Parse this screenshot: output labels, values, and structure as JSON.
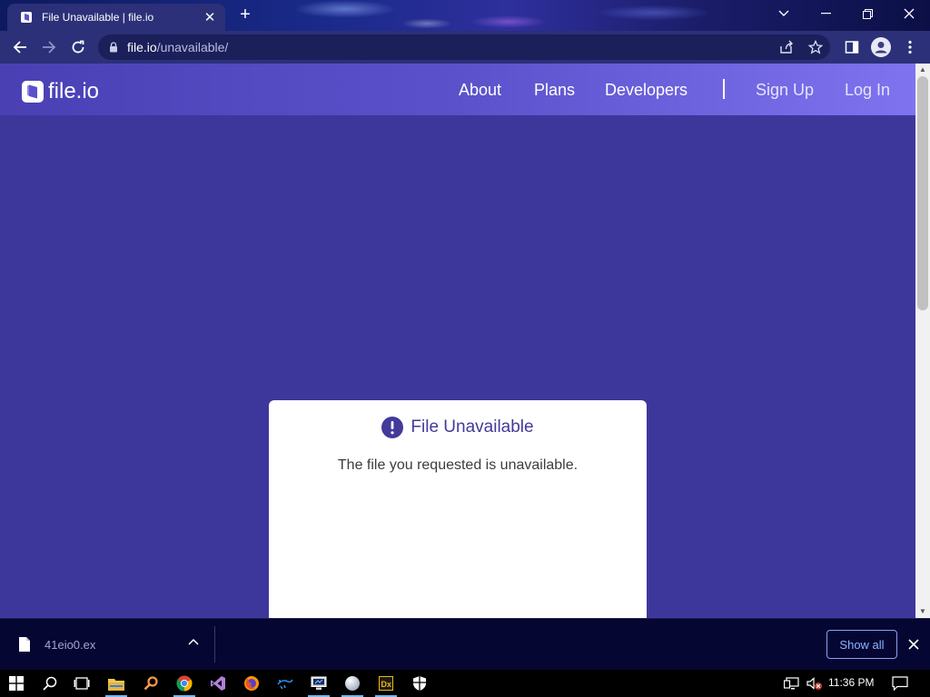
{
  "browser": {
    "tab": {
      "title": "File Unavailable | file.io"
    },
    "address": {
      "host": "file.io",
      "path": "/unavailable/"
    }
  },
  "site": {
    "logo_text": "file.io",
    "nav": {
      "about": "About",
      "plans": "Plans",
      "developers": "Developers",
      "sign_up": "Sign Up",
      "log_in": "Log In"
    },
    "card": {
      "title": "File Unavailable",
      "message": "The file you requested is unavailable."
    },
    "colors": {
      "page_bg": "#3e379b",
      "accent": "#433a9a",
      "header_end": "#7f73ef"
    }
  },
  "download_bar": {
    "file_name": "41eio0.ex",
    "show_all": "Show all"
  },
  "taskbar": {
    "clock": "11:36 PM",
    "apps": [
      "windows-start",
      "search",
      "task-view",
      "file-explorer",
      "search-everything",
      "chrome",
      "visual-studio",
      "firefox-dev",
      "kali-app",
      "remote-desktop",
      "white-ball-app",
      "dx-app",
      "defender"
    ]
  }
}
